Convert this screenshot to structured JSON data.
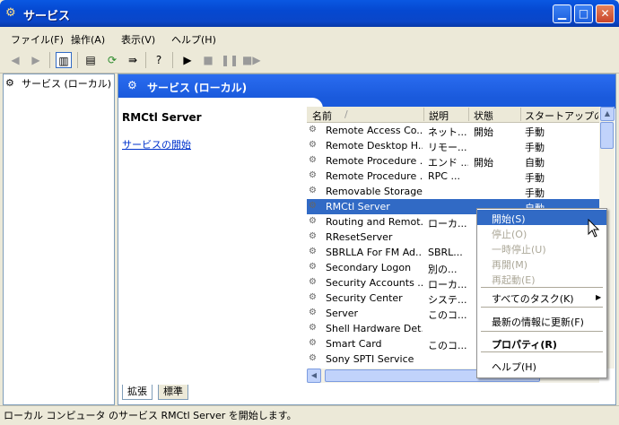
{
  "window": {
    "title": "サービス"
  },
  "menu": [
    "ファイル(F)",
    "操作(A)",
    "表示(V)",
    "ヘルプ(H)"
  ],
  "toolbar": {
    "icons": [
      "back-arrow-icon",
      "forward-arrow-icon",
      "console-tree-icon",
      "properties-icon",
      "refresh-icon",
      "export-list-icon",
      "help-icon",
      "play-icon",
      "stop-icon",
      "pause-icon",
      "restart-icon"
    ]
  },
  "tree": {
    "root_label": "サービス (ローカル)"
  },
  "pane": {
    "header": "サービス (ローカル)",
    "selected_name": "RMCtl Server",
    "start_link": "サービスの開始"
  },
  "list": {
    "columns": [
      "名前",
      "/",
      "説明",
      "状態",
      "スタートアップの種"
    ],
    "rows": [
      {
        "name": "Remote Access Co...",
        "desc": "ネット...",
        "status": "開始",
        "startup": "手動"
      },
      {
        "name": "Remote Desktop H...",
        "desc": "リモー...",
        "status": "",
        "startup": "手動"
      },
      {
        "name": "Remote Procedure ...",
        "desc": "エンド ...",
        "status": "開始",
        "startup": "自動"
      },
      {
        "name": "Remote Procedure ...",
        "desc": "RPC ...",
        "status": "",
        "startup": "手動"
      },
      {
        "name": "Removable Storage",
        "desc": "",
        "status": "",
        "startup": "手動"
      },
      {
        "name": "RMCtl Server",
        "desc": "",
        "status": "",
        "startup": "自動",
        "selected": true
      },
      {
        "name": "Routing and Remot...",
        "desc": "ローカ...",
        "status": "",
        "startup": ""
      },
      {
        "name": "RResetServer",
        "desc": "",
        "status": "",
        "startup": ""
      },
      {
        "name": "SBRLLA For FM Ad...",
        "desc": "SBRL...",
        "status": "",
        "startup": ""
      },
      {
        "name": "Secondary Logon",
        "desc": "別の...",
        "status": "",
        "startup": ""
      },
      {
        "name": "Security Accounts ...",
        "desc": "ローカ...",
        "status": "",
        "startup": ""
      },
      {
        "name": "Security Center",
        "desc": "システ...",
        "status": "",
        "startup": ""
      },
      {
        "name": "Server",
        "desc": "このコ...",
        "status": "",
        "startup": ""
      },
      {
        "name": "Shell Hardware Det...",
        "desc": "",
        "status": "",
        "startup": ""
      },
      {
        "name": "Smart Card",
        "desc": "このコ...",
        "status": "",
        "startup": ""
      },
      {
        "name": "Sony SPTI Service",
        "desc": "",
        "status": "",
        "startup": ""
      }
    ]
  },
  "tabs": [
    "拡張",
    "標準"
  ],
  "status": "ローカル コンピュータ のサービス RMCtl Server を開始します。",
  "context_menu": {
    "items": [
      {
        "label": "開始(S)",
        "state": "highlighted"
      },
      {
        "label": "停止(O)",
        "state": "disabled"
      },
      {
        "label": "一時停止(U)",
        "state": "disabled"
      },
      {
        "label": "再開(M)",
        "state": "disabled"
      },
      {
        "label": "再起動(E)",
        "state": "disabled"
      },
      {
        "label": "すべてのタスク(K)",
        "state": "submenu"
      },
      {
        "label": "最新の情報に更新(F)",
        "state": "normal"
      },
      {
        "label": "プロパティ(R)",
        "state": "bold"
      },
      {
        "label": "ヘルプ(H)",
        "state": "normal"
      }
    ]
  },
  "colors": {
    "title_blue": "#0548d0",
    "selection": "#316ac5",
    "pane_header": "#1a5adc",
    "link": "#0033cc"
  }
}
